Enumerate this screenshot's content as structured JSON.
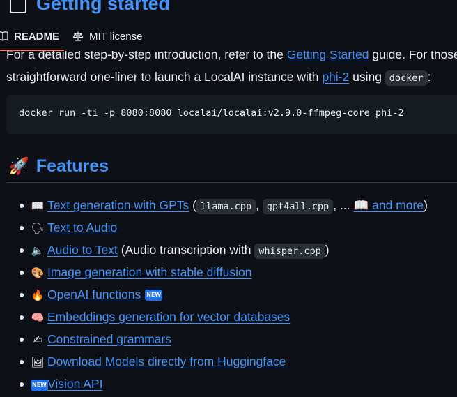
{
  "heading_peek": {
    "text": "Getting started"
  },
  "tabs": [
    {
      "label": "README",
      "icon": "book-icon",
      "active": true
    },
    {
      "label": "MIT license",
      "icon": "scale-icon",
      "active": false
    }
  ],
  "intro": {
    "line1_pre": "For a detailed step-by-step introduction, refer to the ",
    "line1_link": "Getting Started",
    "line1_post": " guide. For those",
    "line2_pre": "straightforward one-liner to launch a LocalAI instance with ",
    "line2_link": "phi-2",
    "line2_mid": " using ",
    "line2_code": "docker",
    "line2_post": ":"
  },
  "code_block": "docker run -ti -p 8080:8080 localai/localai:v2.9.0-ffmpeg-core phi-2",
  "features": {
    "emoji": "🚀",
    "title": "Features",
    "items": [
      {
        "icon": "📖",
        "link": "Text generation with GPTs",
        "pre": " (",
        "code1": "llama.cpp",
        "sep1": ", ",
        "code2": "gpt4all.cpp",
        "sep2": ", ... ",
        "link2": "📖 and more",
        "post": ")"
      },
      {
        "icon": "🗣",
        "link": "Text to Audio"
      },
      {
        "icon": "🔈",
        "link": "Audio to Text",
        "pre": " (Audio transcription with ",
        "code1": "whisper.cpp",
        "post": ")"
      },
      {
        "icon": "🎨",
        "link": "Image generation with stable diffusion"
      },
      {
        "icon": "🔥",
        "link": "OpenAI functions",
        "badge": "NEW"
      },
      {
        "icon": "🧠",
        "link": "Embeddings generation for vector databases"
      },
      {
        "icon": "✍",
        "link": "Constrained grammars"
      },
      {
        "icon": "🖼",
        "link": "Download Models directly from Huggingface"
      },
      {
        "icon": "NEW",
        "link": "Vision API"
      }
    ]
  },
  "colors": {
    "background": "#0d1117",
    "text": "#e6edf3",
    "link": "#4493f8",
    "tab_underline": "#f78166",
    "code_bg": "#2a2f36",
    "badge": "#1f6feb"
  }
}
